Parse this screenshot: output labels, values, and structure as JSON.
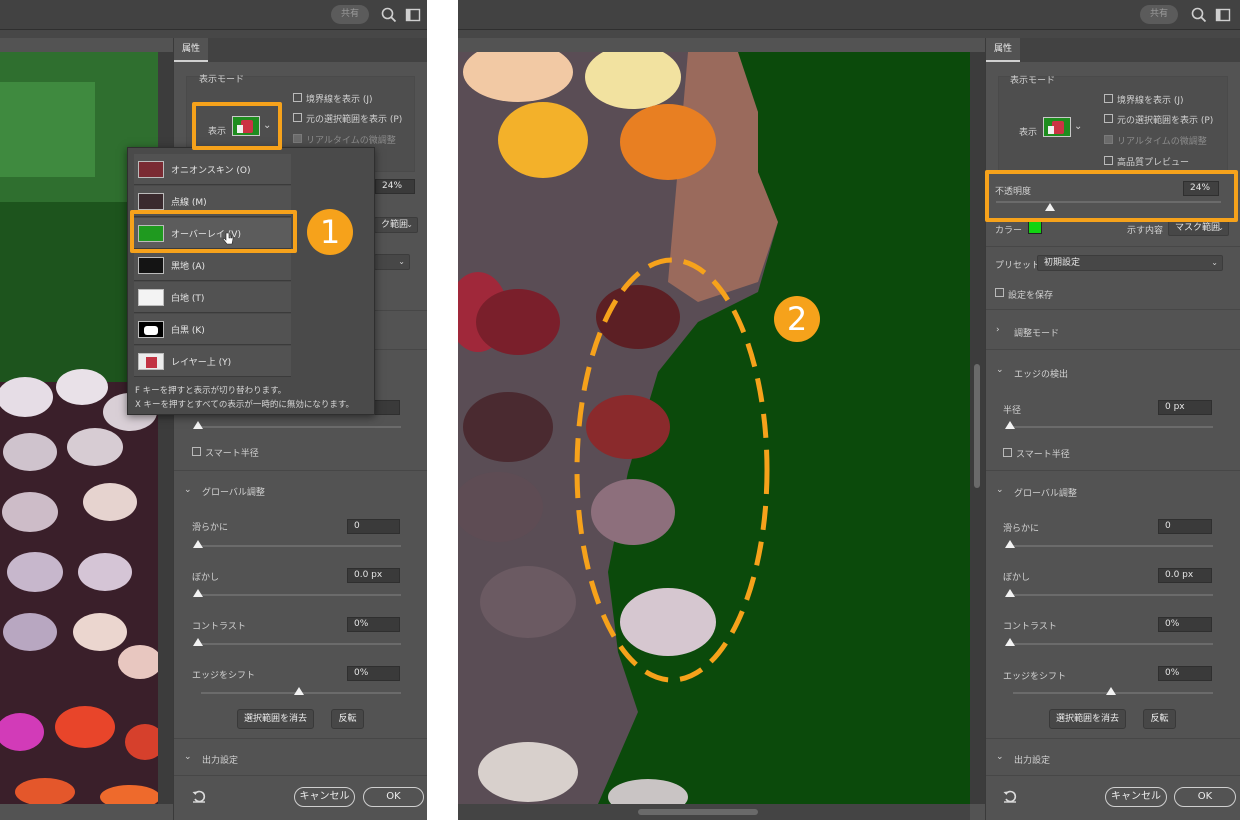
{
  "topbar": {
    "share_label": "共有"
  },
  "panel": {
    "tab_label": "属性",
    "display_mode": {
      "section_label": "表示モード",
      "view_label": "表示",
      "show_edges": "境界線を表示 (J)",
      "show_original": "元の選択範囲を表示 (P)",
      "realtime_refine": "リアルタイムの微調整",
      "high_quality_preview": "高品質プレビュー"
    },
    "opacity": {
      "label": "不透明度",
      "value": "24%",
      "level": 0.24
    },
    "color_label": "カラー",
    "color_value": "#11d411",
    "show_label": "示す内容",
    "show_value": "マスク範囲",
    "preset_label": "プリセット",
    "preset_value": "初期設定",
    "save_settings": "設定を保存",
    "adjust_mode": "調整モード",
    "edge_detection": {
      "section_label": "エッジの検出",
      "radius_label": "半径",
      "radius_value": "0 px",
      "smart_radius": "スマート半径"
    },
    "global": {
      "section_label": "グローバル調整",
      "smooth_label": "滑らかに",
      "smooth_value": "0",
      "feather_label": "ぼかし",
      "feather_value": "0.0 px",
      "contrast_label": "コントラスト",
      "contrast_value": "0%",
      "shift_label": "エッジをシフト",
      "shift_value": "0%",
      "clear_button": "選択範囲を消去",
      "invert_button": "反転"
    },
    "output_label": "出力設定",
    "cancel_button": "キャンセル",
    "ok_button": "OK"
  },
  "dropdown": {
    "items": [
      "オニオンスキン (O)",
      "点線 (M)",
      "オーバーレイ (V)",
      "黒地 (A)",
      "白地 (T)",
      "白黒 (K)",
      "レイヤー上 (Y)"
    ],
    "note1": "F キーを押すと表示が切り替わります。",
    "note2": "X キーを押すとすべての表示が一時的に無効になります。"
  },
  "annotations": {
    "badge1": "1",
    "badge2": "2",
    "accent": "#f6a21b"
  }
}
